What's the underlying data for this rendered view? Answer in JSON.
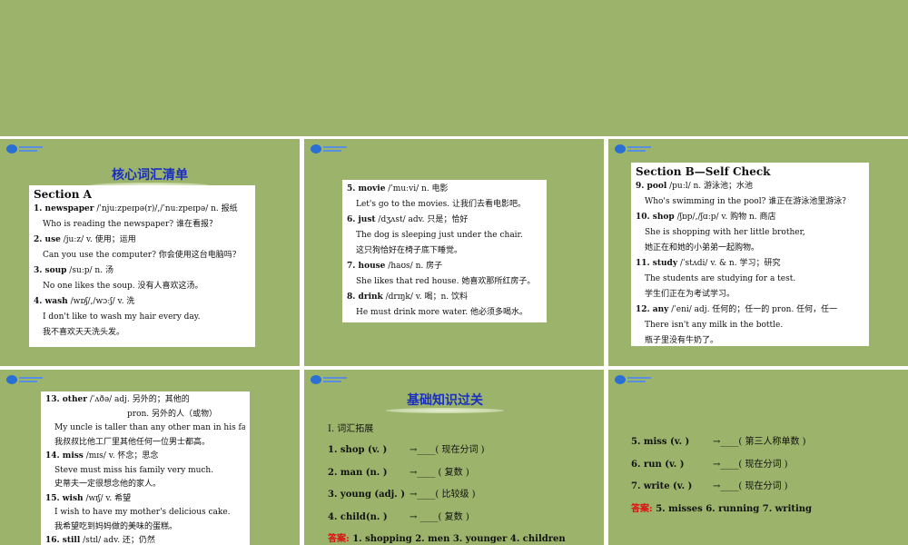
{
  "slide2": {
    "title": "核心词汇清单",
    "section": "Section A",
    "lines": [
      {
        "h": "1. newspaper",
        "t": " /ˈnjuːzpeɪpə(r)/,/ˈnuːzpeɪpə/   n. 报纸"
      },
      {
        "t": "Who is reading the newspaper? 谁在看报？"
      },
      {
        "h": "2. use",
        "t": " /juːz/   v. 使用；运用"
      },
      {
        "t": "Can you use the computer? 你会使用这台电脑吗？"
      },
      {
        "h": "3. soup",
        "t": " /suːp/   n. 汤"
      },
      {
        "t": "No one likes the soup. 没有人喜欢这汤。"
      },
      {
        "h": "4. wash",
        "t": " /wɒʃ/,/wɔːʃ/   v. 洗"
      },
      {
        "t": "I don't like to wash my hair every day."
      },
      {
        "t": "我不喜欢天天洗头发。"
      }
    ]
  },
  "slide3": {
    "lines": [
      {
        "h": "5. movie",
        "t": " /ˈmuːvi/   n. 电影"
      },
      {
        "t": "Let's go to the movies. 让我们去看电影吧。"
      },
      {
        "h": "6. just",
        "t": " /dʒʌst/   adv. 只是；恰好"
      },
      {
        "t": "The dog is sleeping just under the chair."
      },
      {
        "t": "这只狗恰好在椅子底下睡觉。"
      },
      {
        "h": "7. house",
        "t": " /haʊs/   n. 房子"
      },
      {
        "t": "She likes that red house. 她喜欢那所红房子。"
      },
      {
        "h": "8. drink",
        "t": " /drɪŋk/   v. 喝；n. 饮料"
      },
      {
        "t": "He must drink more water. 他必须多喝水。"
      }
    ]
  },
  "slide4": {
    "section": "Section B—Self Check",
    "lines": [
      {
        "h": "9. pool",
        "t": " /puːl/   n. 游泳池；水池"
      },
      {
        "t": "Who's swimming in the pool? 谁正在游泳池里游泳？"
      },
      {
        "h": "10. shop",
        "t": " /ʃɒp/,/ʃɑːp/   v. 购物 n. 商店"
      },
      {
        "t": "She is shopping with her little brother,"
      },
      {
        "t": "她正在和她的小弟弟一起购物。"
      },
      {
        "h": "11. study",
        "t": " /ˈstʌdi/   v. & n. 学习；研究"
      },
      {
        "t": "The students are studying for a test."
      },
      {
        "t": "学生们正在为考试学习。"
      },
      {
        "h": "12. any",
        "t": " /ˈeni/   adj. 任何的；任一的 pron. 任何，任一"
      },
      {
        "t": "There isn't any milk in the bottle."
      },
      {
        "t": "瓶子里没有牛奶了。"
      }
    ]
  },
  "slide5": {
    "lines": [
      {
        "h": "13. other",
        "t": " /ˈʌðə/   adj. 另外的；其他的"
      },
      {
        "t": "pron. 另外的人（或物）",
        "c": "ind2c"
      },
      {
        "t": "My uncle is taller than any other man in his factory."
      },
      {
        "t": "我叔叔比他工厂里其他任何一位男士都高。"
      },
      {
        "h": "14. miss",
        "t": " /mɪs/   v. 怀念；思念"
      },
      {
        "t": "Steve must miss his family very much."
      },
      {
        "t": "史蒂夫一定很想念他的家人。"
      },
      {
        "h": "15. wish",
        "t": " /wɪʃ/   v. 希望"
      },
      {
        "t": "I wish to have my mother's delicious cake."
      },
      {
        "t": "我希望吃到妈妈做的美味的蛋糕。"
      },
      {
        "h": "16. still",
        "t": " /stɪl/   adv. 还；仍然"
      }
    ]
  },
  "slide6": {
    "title": "基础知识过关",
    "heading": "Ⅰ. 词汇拓展",
    "items": [
      {
        "w": "1. shop (v. )",
        "a": "→____( 现在分词 )"
      },
      {
        "w": "2. man (n. )",
        "a": "→____ ( 复数 )"
      },
      {
        "w": "3. young (adj. )",
        "a": "→____( 比较级 )"
      },
      {
        "w": "4. child(n. )",
        "a": "→ ____( 复数 )"
      }
    ],
    "answer_label": "答案:",
    "answer": "1. shopping  2. men  3. younger  4. children"
  },
  "slide7": {
    "items": [
      {
        "w": "5. miss (v. )",
        "a": "→____( 第三人称单数 )"
      },
      {
        "w": "6. run (v. )",
        "a": "→____( 现在分词 )"
      },
      {
        "w": "7. write (v. )",
        "a": "→____( 现在分词 )"
      }
    ],
    "answer_label": "答案:",
    "answer": "5. misses    6. running    7. writing"
  },
  "colors": {
    "slide_bg": "#9bb36a",
    "title_blue": "#1a2fbf",
    "answer_red": "#d11111"
  }
}
